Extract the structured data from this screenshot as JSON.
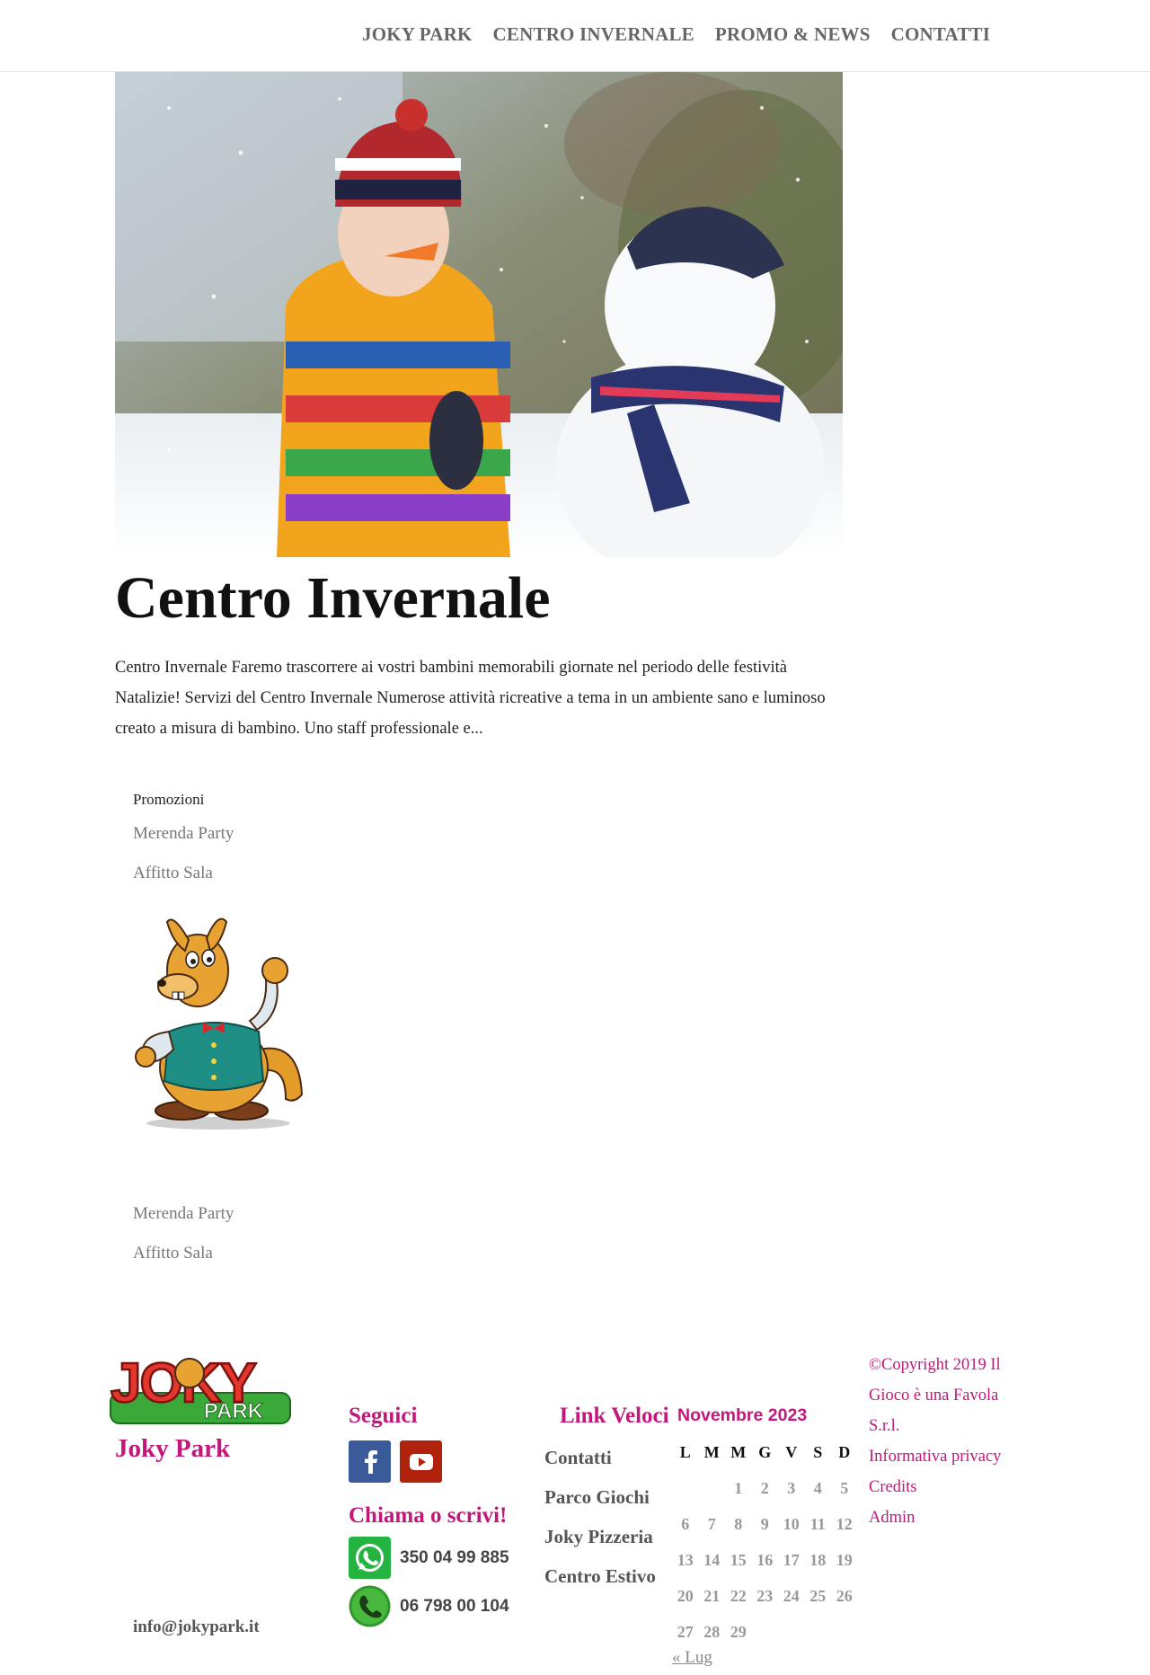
{
  "nav": {
    "items": [
      "JOKY PARK",
      "CENTRO INVERNALE",
      "PROMO & NEWS",
      "CONTATTI"
    ]
  },
  "post": {
    "title": "Centro Invernale",
    "excerpt": "Centro Invernale Faremo trascorrere ai vostri bambini memorabili giornate nel periodo delle festività Natalizie! Servizi del Centro Invernale Numerose attività ricreative a tema in un ambiente sano e luminoso creato a misura di bambino. Uno staff professionale e..."
  },
  "sidebar": {
    "promo_title": "Promozioni",
    "links_top": [
      "Merenda Party",
      "Affitto Sala"
    ],
    "links_bottom": [
      "Merenda Party",
      "Affitto Sala"
    ]
  },
  "footer": {
    "logo_text": "JOKY",
    "logo_sub": "PARK",
    "brand": "Joky Park",
    "email": "info@jokypark.it",
    "seguici": "Seguici",
    "chiama": "Chiama o scrivi!",
    "whatsapp": "350 04 99 885",
    "phone": "06 798 00 104",
    "link_veloci_title": "Link Veloci",
    "quick_links": [
      "Contatti",
      "Parco Giochi",
      "Joky Pizzeria",
      "Centro Estivo"
    ],
    "copyright": "©Copyright 2019 Il Gioco è una Favola S.r.l.",
    "legal_links": [
      "Informativa privacy",
      "Credits",
      "Admin"
    ]
  },
  "calendar": {
    "title": "Novembre 2023",
    "weekdays": [
      "L",
      "M",
      "M",
      "G",
      "V",
      "S",
      "D"
    ],
    "weeks": [
      [
        "",
        "",
        "1",
        "2",
        "3",
        "4",
        "5"
      ],
      [
        "6",
        "7",
        "8",
        "9",
        "10",
        "11",
        "12"
      ],
      [
        "13",
        "14",
        "15",
        "16",
        "17",
        "18",
        "19"
      ],
      [
        "20",
        "21",
        "22",
        "23",
        "24",
        "25",
        "26"
      ],
      [
        "27",
        "28",
        "29",
        "",
        "",
        "",
        ""
      ]
    ],
    "prev_link": "« Lug"
  },
  "colors": {
    "accent": "#c2187c",
    "nav_text": "#666666",
    "facebook": "#3b5a9a",
    "youtube": "#b0220c",
    "whatsapp": "#25b341"
  },
  "icons": {
    "facebook": "facebook-icon",
    "youtube": "youtube-icon",
    "whatsapp": "whatsapp-icon",
    "phone": "phone-icon"
  }
}
